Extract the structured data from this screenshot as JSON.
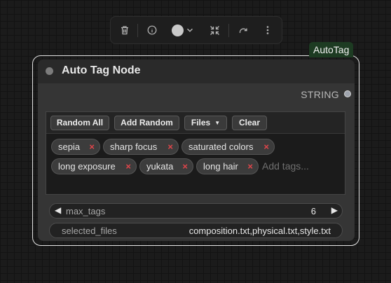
{
  "toolbar": {
    "buttons": [
      {
        "icon": "trash-icon"
      },
      {
        "icon": "info-icon"
      },
      {
        "icon": "color-picker-icon",
        "color": "#c9c9c9"
      },
      {
        "icon": "collapse-icon"
      },
      {
        "icon": "redo-icon"
      },
      {
        "icon": "more-options-icon"
      }
    ]
  },
  "node": {
    "badge": "AutoTag",
    "title": "Auto Tag Node",
    "output_label": "STRING",
    "tag_widget": {
      "buttons": {
        "random_all": "Random All",
        "add_random": "Add Random",
        "files": "Files",
        "files_caret": "▼",
        "clear": "Clear"
      },
      "tags": [
        "sepia",
        "sharp focus",
        "saturated colors",
        "long exposure",
        "yukata",
        "long hair"
      ],
      "remove_glyph": "×",
      "placeholder": "Add tags..."
    },
    "max_tags": {
      "label": "max_tags",
      "value": "6",
      "decrement": "◀",
      "increment": "▶"
    },
    "selected_files": {
      "label": "selected_files",
      "value": "composition.txt,physical.txt,style.txt"
    }
  },
  "colors": {
    "accent_badge": "#1d3b22",
    "tag_remove": "#e0454a",
    "selection_outline": "#e4e4e4"
  }
}
